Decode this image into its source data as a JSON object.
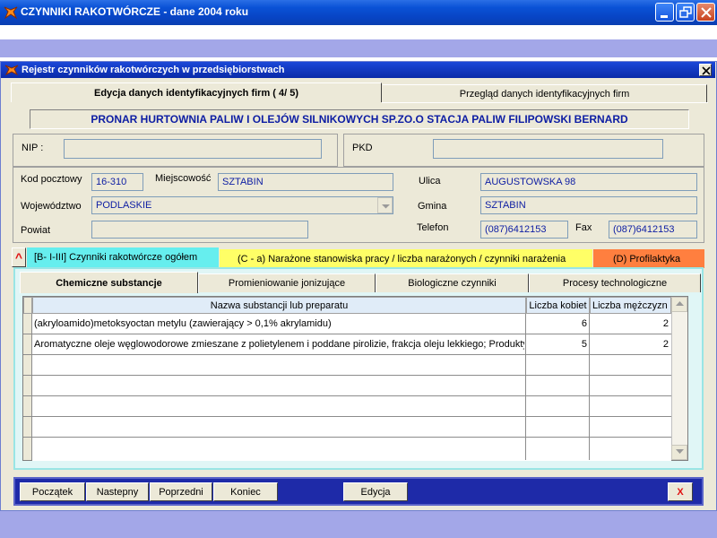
{
  "app": {
    "title": "CZYNNIKI RAKOTWÓRCZE  - dane 2004 roku"
  },
  "window": {
    "title": "Rejestr czynników rakotwórczych w przedsiębiorstwach",
    "close_label": "×"
  },
  "top_tabs": [
    {
      "label": "Edycja danych identyfikacyjnych firm (  4/  5)",
      "active": true
    },
    {
      "label": "Przegląd danych identyfikacyjnych firm",
      "active": false
    }
  ],
  "firm_name": "PRONAR HURTOWNIA PALIW I OLEJÓW SILNIKOWYCH SP.ZO.O STACJA PALIW FILIPOWSKI BERNARD",
  "form": {
    "nip_label": "NIP :",
    "nip_value": "",
    "pkd_label": "PKD",
    "pkd_value": "",
    "kod_label": "Kod pocztowy",
    "kod_value": "16-310",
    "miejscowosc_label": "Miejscowość",
    "miejscowosc_value": "SZTABIN",
    "ulica_label": "Ulica",
    "ulica_value": "AUGUSTOWSKA 98",
    "wojewodztwo_label": "Województwo",
    "wojewodztwo_value": "PODLASKIE",
    "gmina_label": "Gmina",
    "gmina_value": "SZTABIN",
    "powiat_label": "Powiat",
    "powiat_value": "",
    "telefon_label": "Telefon",
    "telefon_value": "(087)6412153",
    "fax_label": "Fax",
    "fax_value": "(087)6412153"
  },
  "category_tabs": {
    "caret": "^",
    "b": "[B- I-III]  Czynniki rakotwórcze ogółem",
    "c": "(C - a)  Narażone stanowiska pracy / liczba narażonych / czynniki narażenia",
    "d": "(D)  Profilaktyka"
  },
  "sub_tabs": [
    "Chemiczne substancje",
    "Promieniowanie jonizujące",
    "Biologiczne czynniki",
    "Procesy technologiczne"
  ],
  "grid": {
    "headers": [
      "Nazwa substancji lub preparatu",
      "Liczba kobiet",
      "Liczba mężczyzn"
    ],
    "rows": [
      {
        "name": "(akryloamido)metoksyoctan metylu (zawierający > 0,1% akrylamidu)",
        "women": "6",
        "men": "2"
      },
      {
        "name": "Aromatyczne oleje węglowodorowe zmieszane z polietylenem i poddane pirolizie, frakcja oleju lekkiego; Produkty",
        "women": "5",
        "men": "2"
      }
    ]
  },
  "nav": {
    "start": "Początek",
    "next": "Nastepny",
    "prev": "Poprzedni",
    "end": "Koniec",
    "edit": "Edycja",
    "close": "X"
  },
  "colors": {
    "titlebar": "#0a52d6",
    "tab_b": "#66eeee",
    "tab_c": "#ffff66",
    "tab_d": "#ff7f3f",
    "nav_bar": "#1e2aa8",
    "field_text": "#0d1da3"
  }
}
